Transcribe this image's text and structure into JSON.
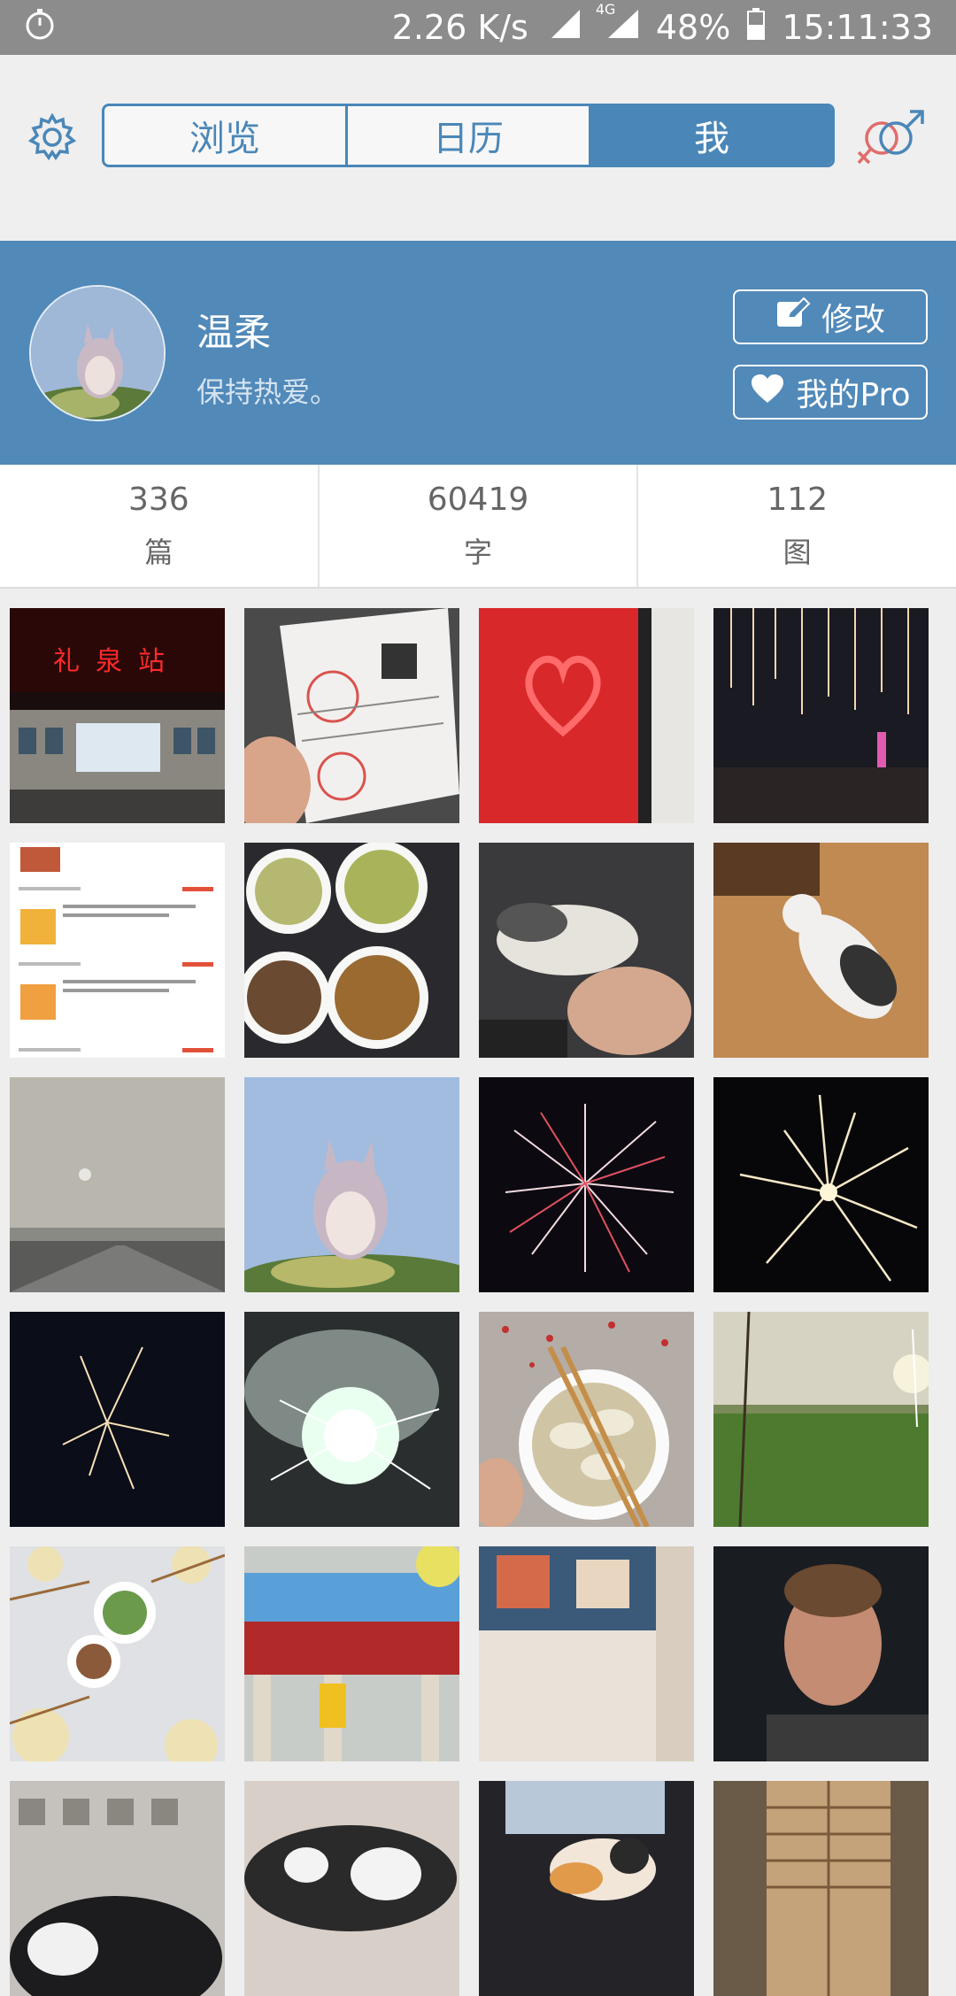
{
  "status_bar": {
    "network_speed": "2.26 K/s",
    "network_type": "4G",
    "battery": "48%",
    "time": "15:11:33",
    "icons": [
      "stopwatch-icon",
      "signal-icon",
      "signal-4g-icon",
      "battery-icon"
    ]
  },
  "nav": {
    "tabs": [
      {
        "label": "浏览",
        "active": false
      },
      {
        "label": "日历",
        "active": false
      },
      {
        "label": "我",
        "active": true
      }
    ],
    "left_icon": "gear-icon",
    "right_icon": "gender-icon"
  },
  "profile": {
    "name": "温柔",
    "motto": "保持热爱。",
    "edit_label": "修改",
    "pro_label": "我的Pro",
    "edit_icon": "edit-icon",
    "pro_icon": "heart-icon"
  },
  "stats": [
    {
      "value": "336",
      "unit": "篇"
    },
    {
      "value": "60419",
      "unit": "字"
    },
    {
      "value": "112",
      "unit": "图"
    }
  ],
  "photos": [
    {
      "name": "photo-train-station",
      "sign_text": "礼泉站"
    },
    {
      "name": "photo-receipt"
    },
    {
      "name": "photo-red-pin-heart"
    },
    {
      "name": "photo-night-lights"
    },
    {
      "name": "photo-order-list"
    },
    {
      "name": "photo-food-plates"
    },
    {
      "name": "photo-cat-hand"
    },
    {
      "name": "photo-cat-floor"
    },
    {
      "name": "photo-foggy-road"
    },
    {
      "name": "photo-totoro"
    },
    {
      "name": "photo-fireworks-1"
    },
    {
      "name": "photo-fireworks-2"
    },
    {
      "name": "photo-fireworks-3"
    },
    {
      "name": "photo-fireworks-smoke"
    },
    {
      "name": "photo-dumplings"
    },
    {
      "name": "photo-green-field"
    },
    {
      "name": "photo-dinner-table"
    },
    {
      "name": "photo-toll-gate"
    },
    {
      "name": "photo-paper-art"
    },
    {
      "name": "photo-man-portrait"
    },
    {
      "name": "photo-cat-building"
    },
    {
      "name": "photo-cat-sleeping"
    },
    {
      "name": "photo-cat-window"
    },
    {
      "name": "photo-lockers"
    }
  ]
}
